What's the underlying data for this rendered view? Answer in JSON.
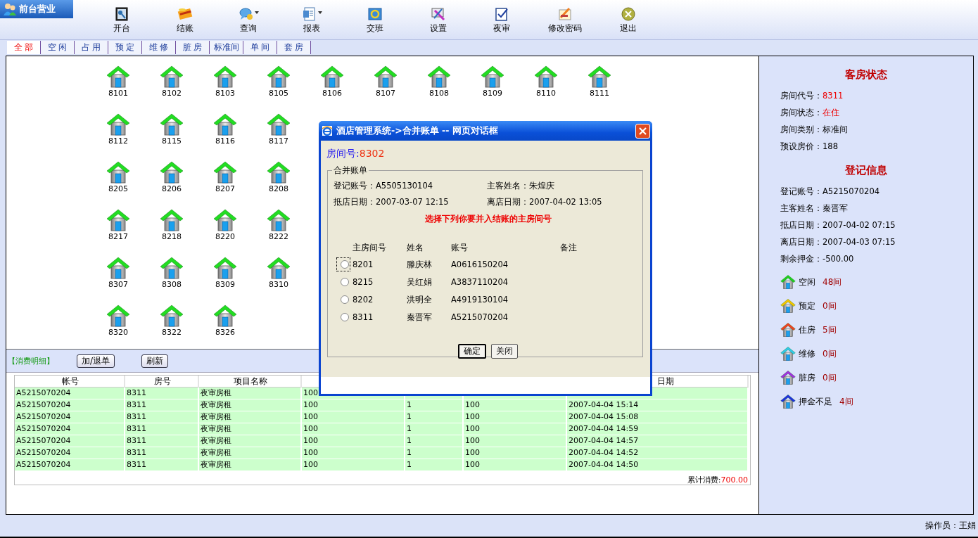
{
  "app_tab": {
    "label": "前台营业"
  },
  "toolbar": [
    {
      "label": "开台",
      "has_menu": false
    },
    {
      "label": "结账",
      "has_menu": false
    },
    {
      "label": "查询",
      "has_menu": true
    },
    {
      "label": "报表",
      "has_menu": true
    },
    {
      "label": "交班",
      "has_menu": false
    },
    {
      "label": "设置",
      "has_menu": false
    },
    {
      "label": "夜审",
      "has_menu": false
    },
    {
      "label": "修改密码",
      "has_menu": false
    },
    {
      "label": "退出",
      "has_menu": false
    }
  ],
  "filter_tabs": [
    {
      "label": "全 部",
      "selected": true
    },
    {
      "label": "空 闲",
      "selected": false
    },
    {
      "label": "占 用",
      "selected": false
    },
    {
      "label": "预 定",
      "selected": false
    },
    {
      "label": "维 修",
      "selected": false
    },
    {
      "label": "脏 房",
      "selected": false
    },
    {
      "label": "标准间",
      "selected": false
    },
    {
      "label": "单 间",
      "selected": false
    },
    {
      "label": "套 房",
      "selected": false
    }
  ],
  "rooms": {
    "rows": [
      [
        "8101",
        "8102",
        "8103",
        "8105",
        "8106",
        "8107",
        "8108",
        "8109",
        "8110",
        "8111"
      ],
      [
        "8112",
        "8115",
        "8116",
        "8117"
      ],
      [
        "8205",
        "8206",
        "8207",
        "8208"
      ],
      [
        "8217",
        "8218",
        "8220",
        "8222"
      ],
      [
        "8307",
        "8308",
        "8309",
        "8310"
      ],
      [
        "8320",
        "8322",
        "8326"
      ]
    ]
  },
  "detail": {
    "title": "【消费明细】",
    "buttons": [
      "加/退单",
      "刷新"
    ],
    "columns": [
      "帐号",
      "房号",
      "项目名称",
      null,
      null,
      null,
      "日期"
    ],
    "rows": [
      [
        "A5215070204",
        "8311",
        "夜审房租",
        "100",
        null,
        null,
        null
      ],
      [
        "A5215070204",
        "8311",
        "夜审房租",
        "100",
        "1",
        "100",
        "2007-04-04 15:14"
      ],
      [
        "A5215070204",
        "8311",
        "夜审房租",
        "100",
        "1",
        "100",
        "2007-04-04 15:08"
      ],
      [
        "A5215070204",
        "8311",
        "夜审房租",
        "100",
        "1",
        "100",
        "2007-04-04 14:59"
      ],
      [
        "A5215070204",
        "8311",
        "夜审房租",
        "100",
        "1",
        "100",
        "2007-04-04 14:57"
      ],
      [
        "A5215070204",
        "8311",
        "夜审房租",
        "100",
        "1",
        "100",
        "2007-04-04 14:52"
      ],
      [
        "A5215070204",
        "8311",
        "夜审房租",
        "100",
        "1",
        "100",
        "2007-04-04 14:50"
      ]
    ],
    "total_label": "累计消费:",
    "total_value": "700.00"
  },
  "status_panel": {
    "sections": [
      {
        "title": "客房状态",
        "fields": [
          {
            "label": "房间代号：",
            "value": "8311",
            "highlight": true
          },
          {
            "label": "房间状态：",
            "value": "在住",
            "highlight": true
          },
          {
            "label": "房间类别：",
            "value": "标准间",
            "highlight": false
          },
          {
            "label": "预设房价：",
            "value": "188",
            "highlight": false
          }
        ]
      },
      {
        "title": "登记信息",
        "fields": [
          {
            "label": "登记账号：",
            "value": "A5215070204",
            "highlight": false
          },
          {
            "label": "主客姓名：",
            "value": "秦晋军",
            "highlight": false
          },
          {
            "label": "抵店日期：",
            "value": "2007-04-02 07:15",
            "highlight": false
          },
          {
            "label": "离店日期：",
            "value": "2007-04-03 07:15",
            "highlight": false
          },
          {
            "label": "剩余押金：",
            "value": "-500.00",
            "highlight": false
          }
        ]
      }
    ],
    "legend": [
      {
        "label": "空闲",
        "count": "48间",
        "color": "#22cc22"
      },
      {
        "label": "预定",
        "count": "0间",
        "color": "#f5c400"
      },
      {
        "label": "住房",
        "count": "5间",
        "color": "#f04020"
      },
      {
        "label": "维修",
        "count": "0间",
        "color": "#30c8e8"
      },
      {
        "label": "脏房",
        "count": "0间",
        "color": "#a030e0"
      },
      {
        "label": "押金不足",
        "count": "4间",
        "color": "#2030e0"
      }
    ]
  },
  "dialog": {
    "title": "酒店管理系统->合并账单 -- 网页对话框",
    "room_label": "房间号:",
    "room_value": "8302",
    "group_title": "合并账单",
    "info": [
      {
        "label": "登记账号：",
        "value": "A5505130104"
      },
      {
        "label": "主客姓名：",
        "value": "朱煌庆"
      },
      {
        "label": "抵店日期：",
        "value": "2007-03-07 12:15"
      },
      {
        "label": "离店日期：",
        "value": "2007-04-02 13:05"
      }
    ],
    "prompt": "选择下列你要并入结账的主房间号",
    "columns": [
      "主房间号",
      "姓名",
      "账号",
      "备注"
    ],
    "candidates": [
      {
        "room": "8201",
        "name": "滕庆林",
        "account": "A0616150204",
        "selected": false,
        "focused": true
      },
      {
        "room": "8215",
        "name": "吴红娟",
        "account": "A3837110204",
        "selected": false,
        "focused": false
      },
      {
        "room": "8202",
        "name": "洪明全",
        "account": "A4919130104",
        "selected": false,
        "focused": false
      },
      {
        "room": "8311",
        "name": "秦晋军",
        "account": "A5215070204",
        "selected": false,
        "focused": false
      }
    ],
    "buttons": [
      {
        "label": "确定",
        "default": true
      },
      {
        "label": "关闭",
        "default": false
      }
    ]
  },
  "status_bar": {
    "operator": "操作员：王娟"
  }
}
